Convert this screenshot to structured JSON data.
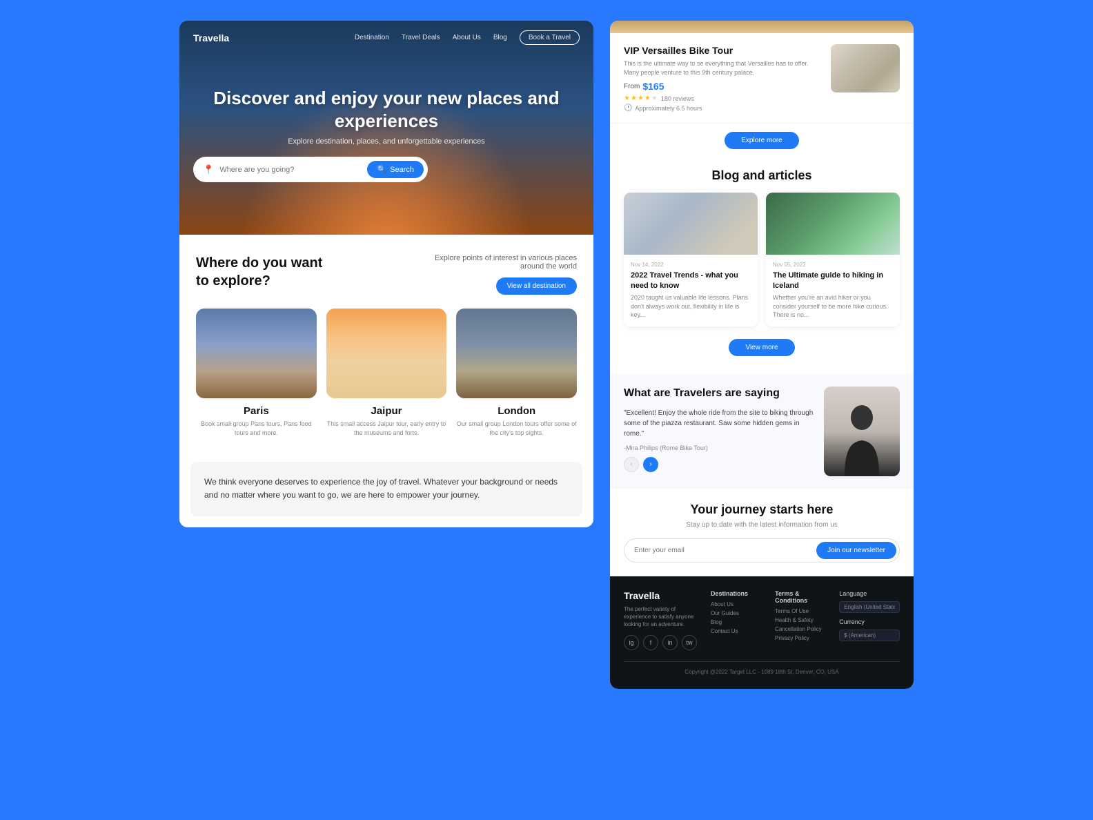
{
  "leftPanel": {
    "nav": {
      "logo": "Travella",
      "links": [
        "Destination",
        "Travel Deals",
        "About Us",
        "Blog"
      ],
      "bookLabel": "Book a Travel"
    },
    "hero": {
      "title": "Discover and enjoy your new places and experiences",
      "subtitle": "Explore destination, places, and unforgettable experiences",
      "searchPlaceholder": "Where are you going?",
      "searchLabel": "Search"
    },
    "explore": {
      "title": "Where do you want to explore?",
      "description": "Explore points of interest in various places around the world",
      "viewAllLabel": "View all destination",
      "destinations": [
        {
          "name": "Paris",
          "description": "Book small group Paris tours, Paris food tours and more."
        },
        {
          "name": "Jaipur",
          "description": "This small access Jaipur tour, early entry to the museums and forts."
        },
        {
          "name": "London",
          "description": "Our small group London tours offer some of the city's top sights."
        }
      ]
    },
    "statement": {
      "text": "We think everyone deserves to experience the joy of travel. Whatever your background or needs and no matter where you want to go, we are here to empower your journey."
    }
  },
  "rightPanel": {
    "vip": {
      "title": "VIP Versailles Bike Tour",
      "description": "This is the ultimate way to se everything that Versailles has to offer. Many people venture to this 9th century palace.",
      "from": "From",
      "price": "$165",
      "stars": 4,
      "reviews": "180 reviews",
      "duration": "Approximately 6.5 hours",
      "exploreMoreLabel": "Explore more"
    },
    "blog": {
      "sectionTitle": "Blog and articles",
      "articles": [
        {
          "date": "Nov 14, 2022",
          "title": "2022 Travel Trends - what you need to know",
          "description": "2020 taught us valuable life lessons. Plans don't always work out, flexibility in life is key..."
        },
        {
          "date": "Nov 05, 2022",
          "title": "The Ultimate guide to hiking in Iceland",
          "description": "Whether you're an avid hiker or you consider yourself to be more hike curious. There is no..."
        }
      ],
      "viewMoreLabel": "View more"
    },
    "testimonial": {
      "heading": "What are Travelers are saying",
      "quote": "\"Excellent! Enjoy the whole ride from the site to biking through some of the piazza restaurant. Saw some hidden gems in rome.\"",
      "author": "-Mira Philips",
      "tourLabel": "(Rome Bike Tour)"
    },
    "newsletter": {
      "title": "Your journey starts here",
      "subtitle": "Stay up to date with the latest information from us",
      "placeholder": "Enter your email",
      "buttonLabel": "Join our newsletter"
    },
    "footer": {
      "logo": "Travella",
      "tagline": "The perfect variety of experience to satisfy anyone looking for an adventure.",
      "socials": [
        "ig",
        "fb",
        "in",
        "tw"
      ],
      "columns": [
        {
          "title": "Destinations",
          "links": [
            "About Us",
            "Our Guides",
            "Blog",
            "Contact Us"
          ]
        },
        {
          "title": "Terms & Conditions",
          "links": [
            "Terms Of Use",
            "Health & Safety",
            "Cancellation Policy",
            "Privacy Policy"
          ]
        }
      ],
      "rightSection": {
        "languageLabel": "Language",
        "languagePlaceholder": "English (United States)",
        "currencyLabel": "Currency",
        "currencyPlaceholder": "$ (American)"
      },
      "copyright": "Copyright @2022 Target LLC - 1089 18th St, Denver, CO, USA"
    }
  }
}
